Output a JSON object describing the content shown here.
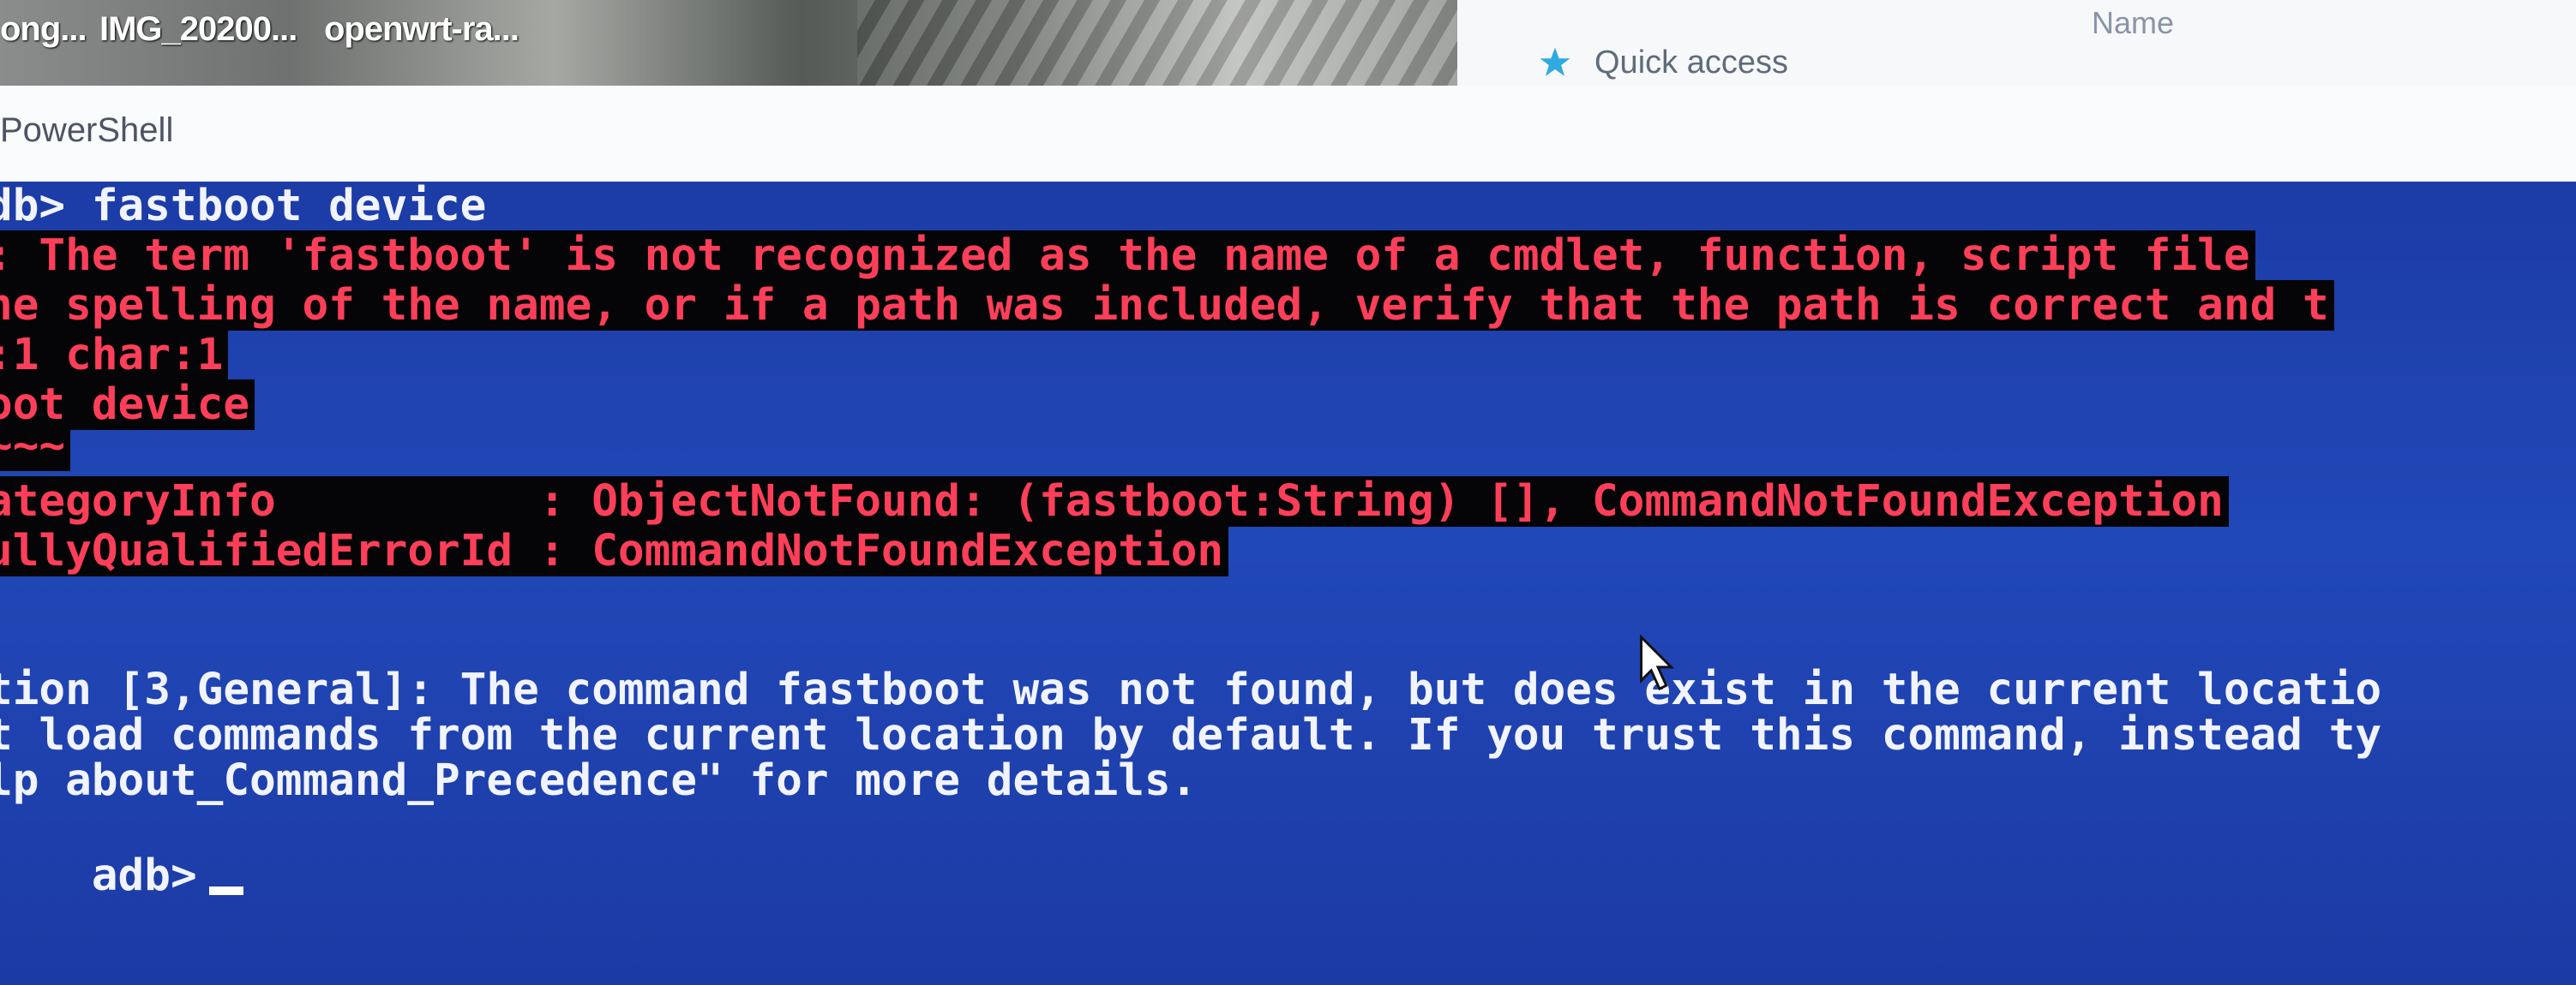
{
  "taskbar": {
    "files": [
      "ong...",
      "IMG_20200...",
      "openwrt-ra..."
    ]
  },
  "explorer": {
    "column_name": "Name",
    "quick_access": "Quick access"
  },
  "window": {
    "title": "PowerShell"
  },
  "console": {
    "prompt_command": "db> fastboot device",
    "error_lines": [
      ": The term 'fastboot' is not recognized as the name of a cmdlet, function, script file",
      "ne spelling of the name, or if a path was included, verify that the path is correct and t",
      ":1 char:1",
      "oot device",
      "~~~",
      "ategoryInfo          : ObjectNotFound: (fastboot:String) [], CommandNotFoundException",
      "ullyQualifiedErrorId : CommandNotFoundException"
    ],
    "suggestion_lines": [
      "tion [3,General]: The command fastboot was not found, but does exist in the current locatio",
      "t load commands from the current location by default. If you trust this command, instead ty",
      "lp about_Command_Precedence\" for more details."
    ],
    "final_prompt": "adb>"
  },
  "colors": {
    "console_bg": "#1f3fa8",
    "error_fg": "#ff3f59",
    "error_bg": "#050508",
    "text_fg": "#f1f4ff"
  }
}
